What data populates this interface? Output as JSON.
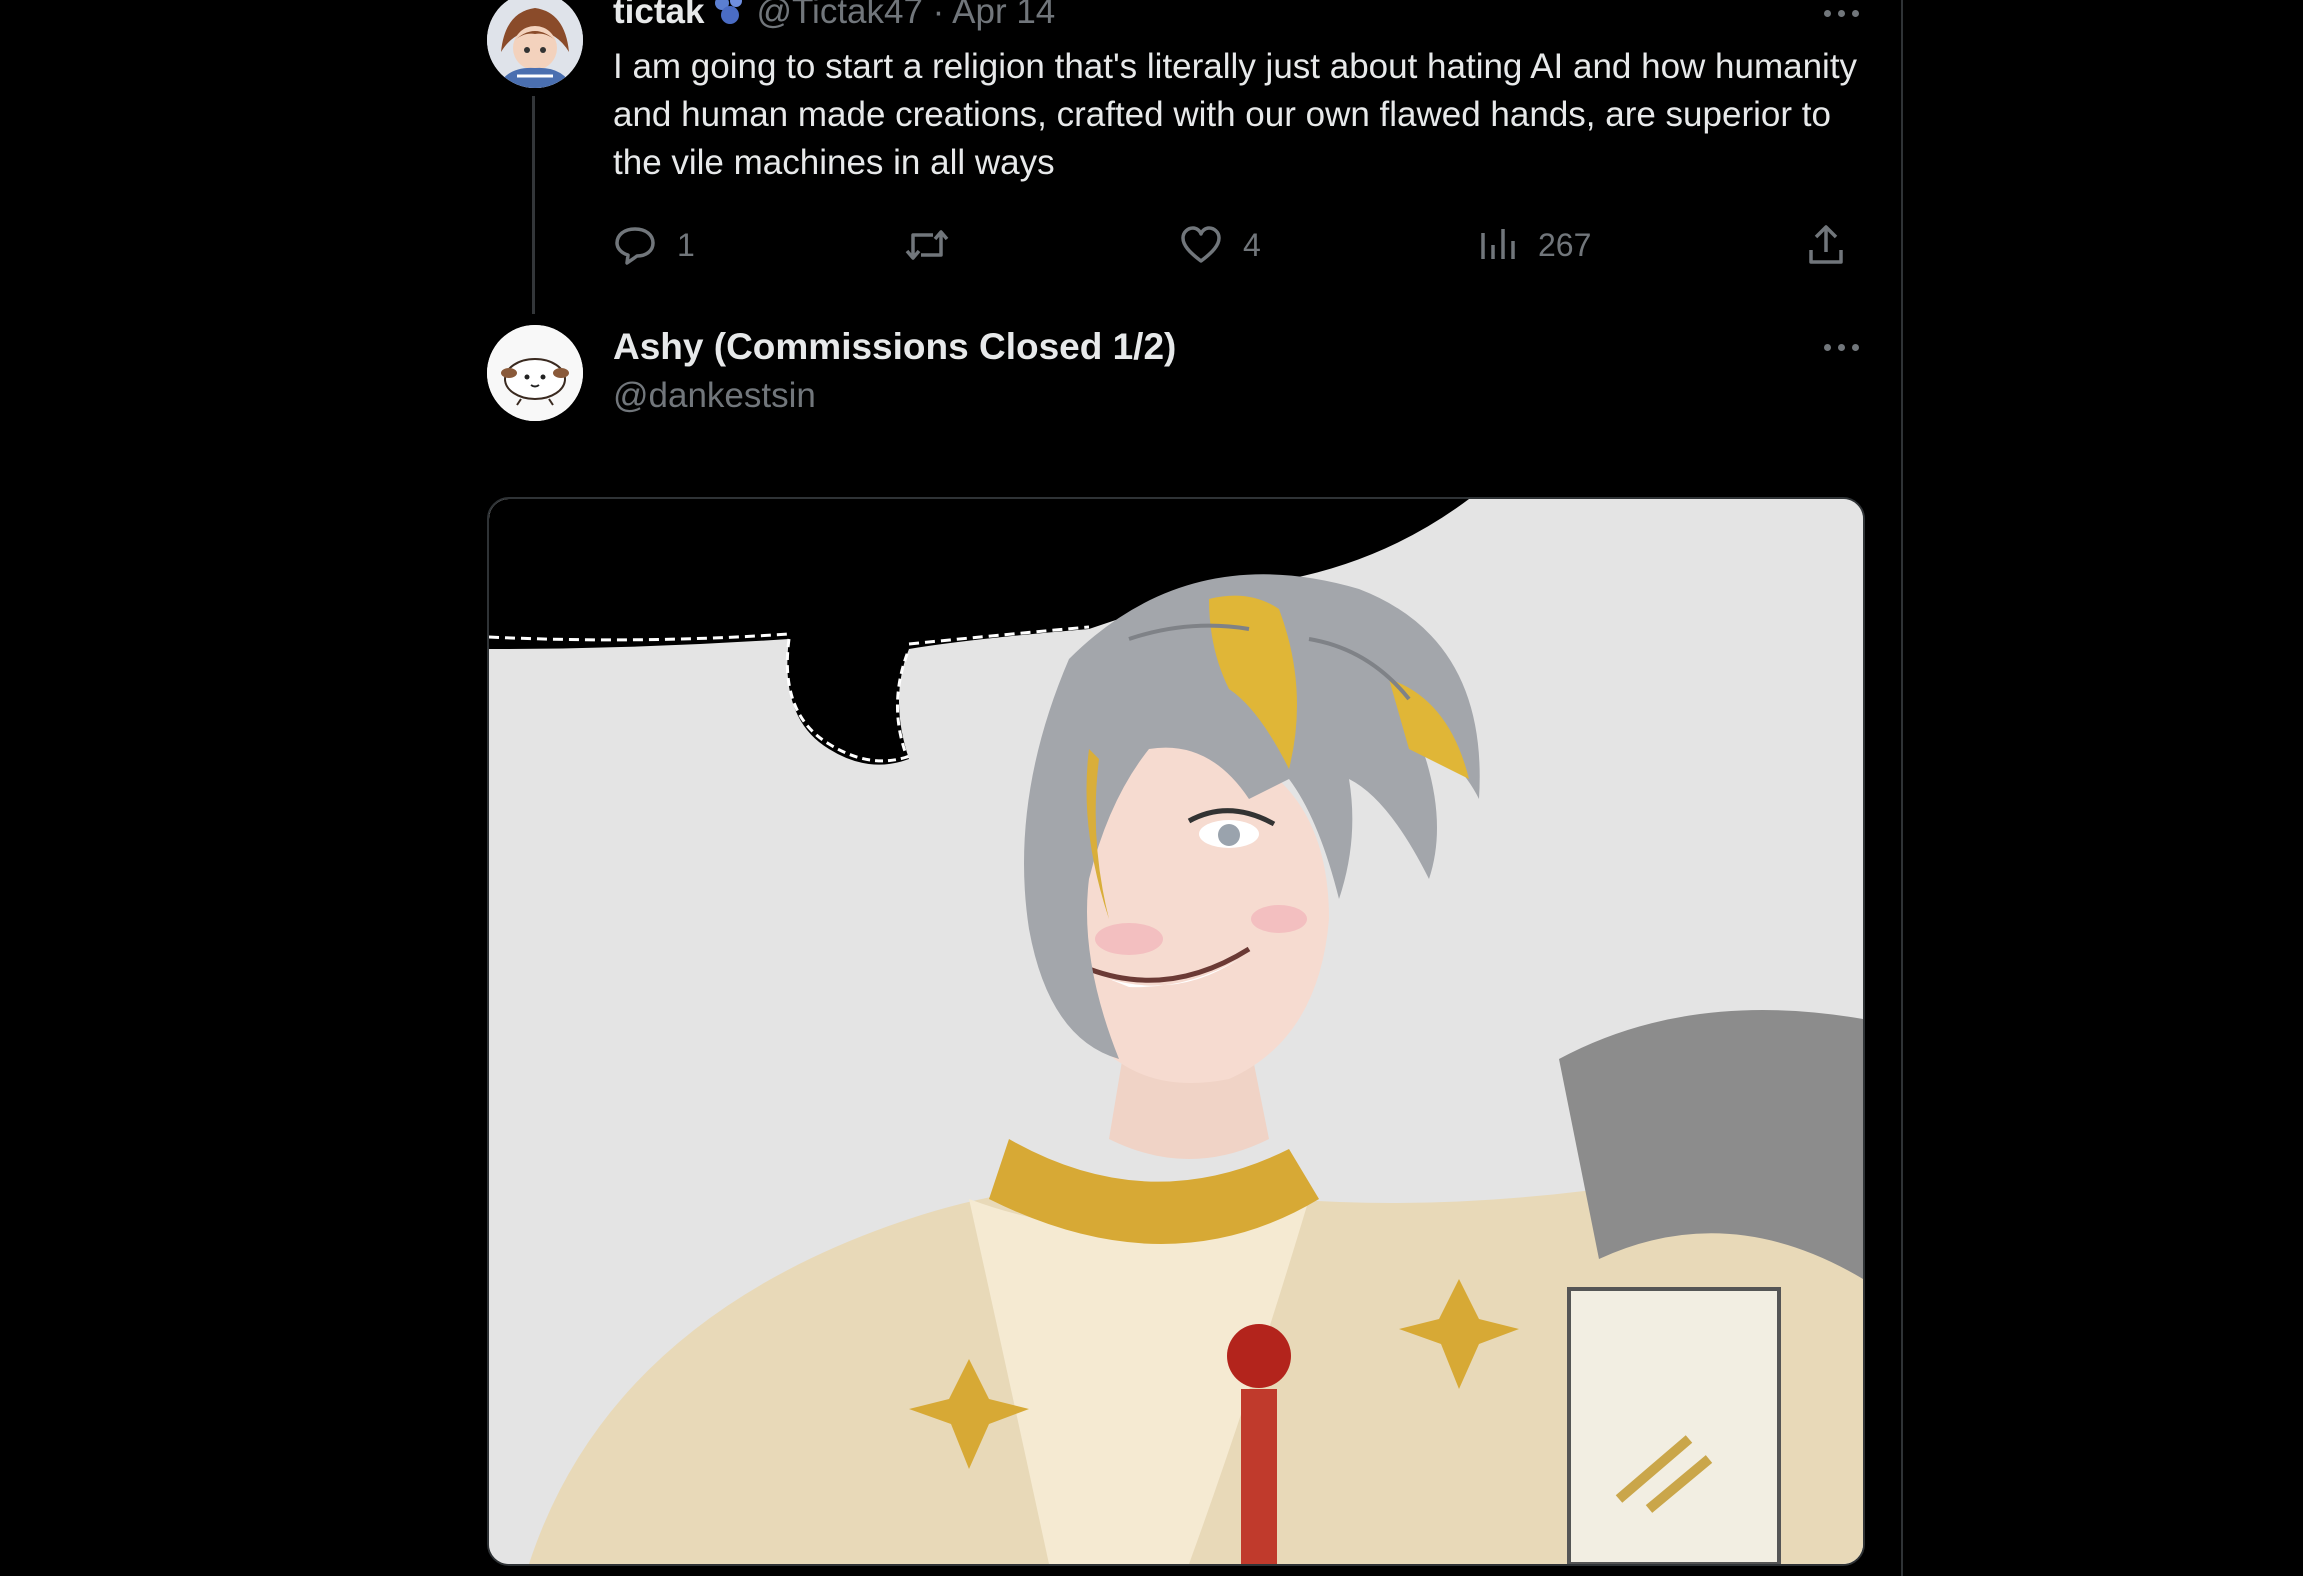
{
  "tweet1": {
    "name": "tictak",
    "handle": "@Tictak47",
    "separator": " · ",
    "date": "Apr 14",
    "text": "I am going to start a religion that's literally just about hating AI and how humanity and human made creations, crafted with our own flawed hands, are superior to the vile machines in all ways",
    "actions": {
      "replies": "1",
      "retweets": "",
      "likes": "4",
      "views": "267"
    }
  },
  "tweet2": {
    "name": "Ashy (Commissions Closed 1/2)",
    "handle": "@dankestsin"
  },
  "icons": {
    "reply": "reply-icon",
    "retweet": "retweet-icon",
    "like": "heart-icon",
    "views": "views-chart-icon",
    "share": "share-icon",
    "more": "more-icon",
    "badge": "verified-badge-icon"
  },
  "colors": {
    "background": "#000000",
    "text": "#e7e9ea",
    "muted": "#71767b",
    "border": "#2f3336",
    "badge": "#5b7fd1"
  }
}
